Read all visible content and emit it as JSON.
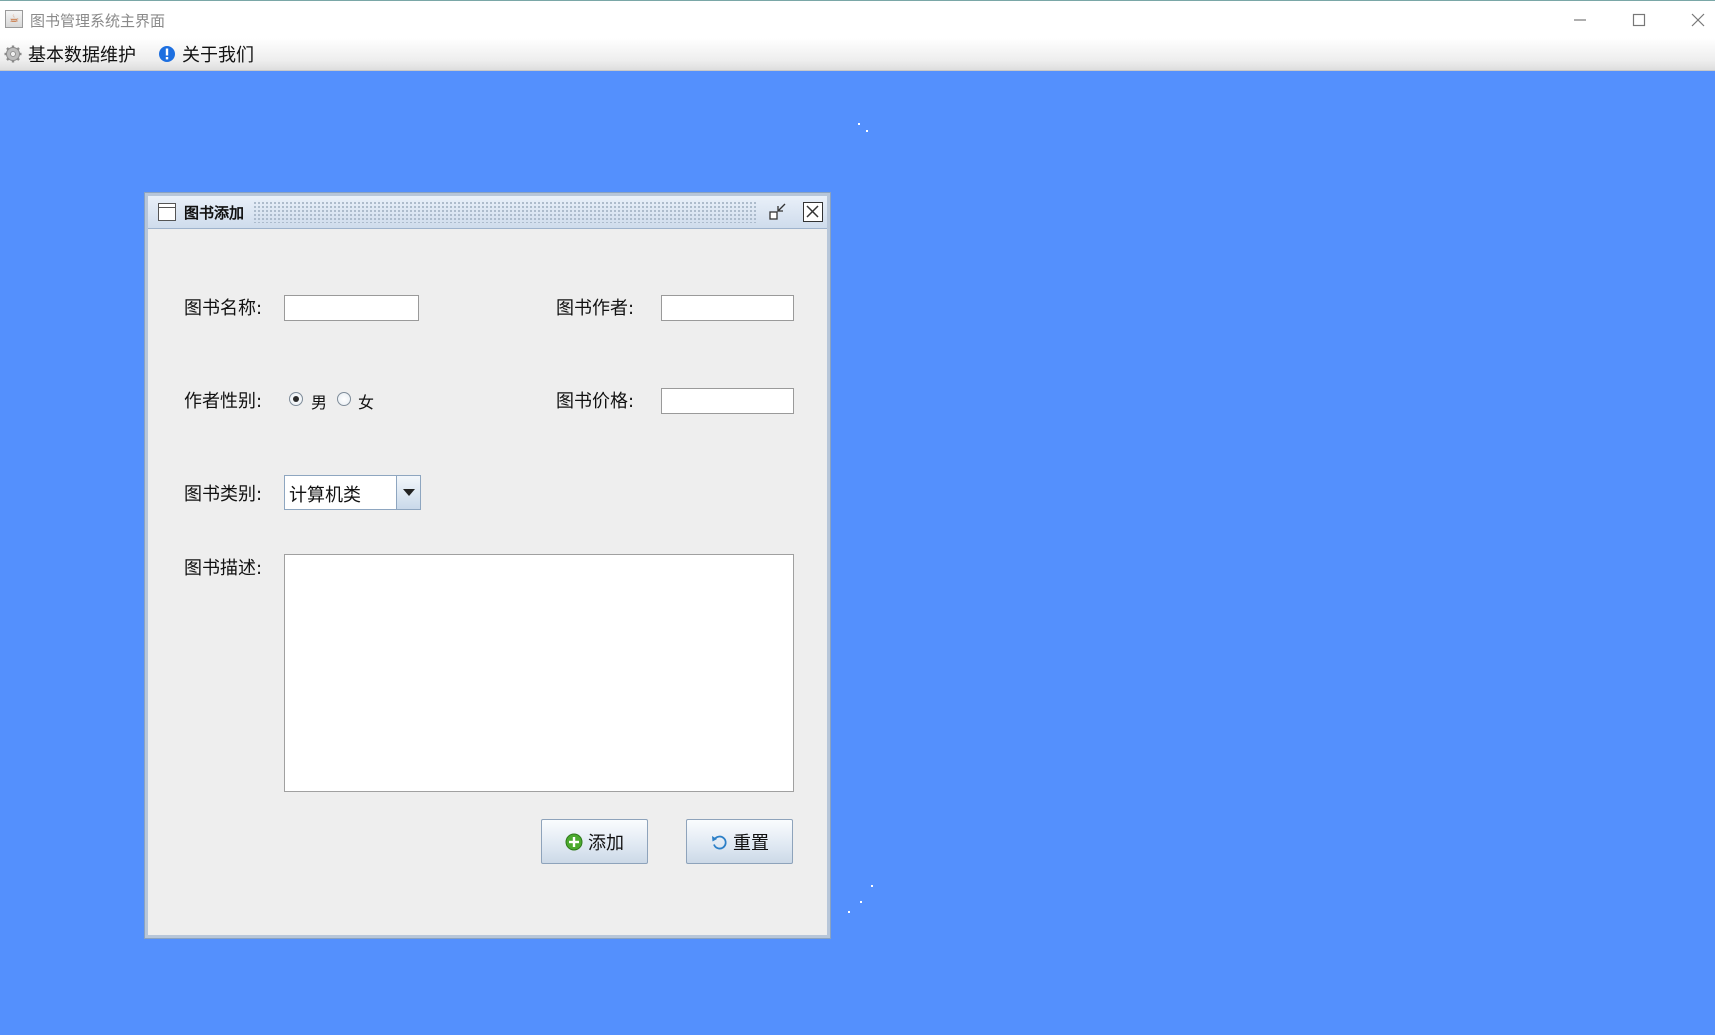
{
  "window": {
    "title": "图书管理系统主界面",
    "icon": "java-cup-icon"
  },
  "menubar": {
    "items": [
      {
        "label": "基本数据维护",
        "icon": "gear-icon"
      },
      {
        "label": "关于我们",
        "icon": "info-icon"
      }
    ]
  },
  "colors": {
    "desktop": "#5490fd",
    "frame_bg": "#eeeeee",
    "frame_title": "#cfdcec"
  },
  "dialog": {
    "title": "图书添加",
    "fields": {
      "book_name_label": "图书名称:",
      "book_name_value": "",
      "book_author_label": "图书作者:",
      "book_author_value": "",
      "author_gender_label": "作者性别:",
      "gender_male": "男",
      "gender_female": "女",
      "gender_selected": "男",
      "book_price_label": "图书价格:",
      "book_price_value": "",
      "book_type_label": "图书类别:",
      "book_type_value": "计算机类",
      "book_desc_label": "图书描述:",
      "book_desc_value": ""
    },
    "buttons": {
      "add": "添加",
      "reset": "重置"
    }
  }
}
